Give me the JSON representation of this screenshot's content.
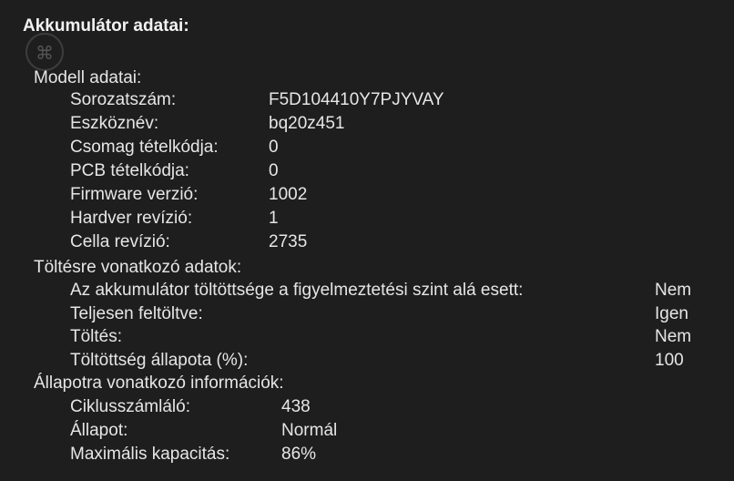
{
  "title": "Akkumulátor adatai:",
  "icons": {
    "command": "command-key-icon"
  },
  "model": {
    "heading": "Modell adatai:",
    "rows": [
      {
        "label": "Sorozatszám:",
        "value": "F5D104410Y7PJYVAY"
      },
      {
        "label": "Eszköznév:",
        "value": "bq20z451"
      },
      {
        "label": "Csomag tételkódja:",
        "value": "0"
      },
      {
        "label": "PCB tételkódja:",
        "value": "0"
      },
      {
        "label": "Firmware verzió:",
        "value": "1002"
      },
      {
        "label": "Hardver revízió:",
        "value": "1"
      },
      {
        "label": "Cella revízió:",
        "value": "2735"
      }
    ]
  },
  "charge": {
    "heading": "Töltésre vonatkozó adatok:",
    "rows": [
      {
        "label": "Az akkumulátor töltöttsége a figyelmeztetési szint alá esett:",
        "value": "Nem"
      },
      {
        "label": "Teljesen feltöltve:",
        "value": "Igen"
      },
      {
        "label": "Töltés:",
        "value": "Nem"
      },
      {
        "label": "Töltöttség állapota (%):",
        "value": "100"
      }
    ]
  },
  "health": {
    "heading": "Állapotra vonatkozó információk:",
    "rows": [
      {
        "label": "Ciklusszámláló:",
        "value": "438"
      },
      {
        "label": "Állapot:",
        "value": "Normál"
      },
      {
        "label": "Maximális kapacitás:",
        "value": "86%"
      }
    ]
  }
}
